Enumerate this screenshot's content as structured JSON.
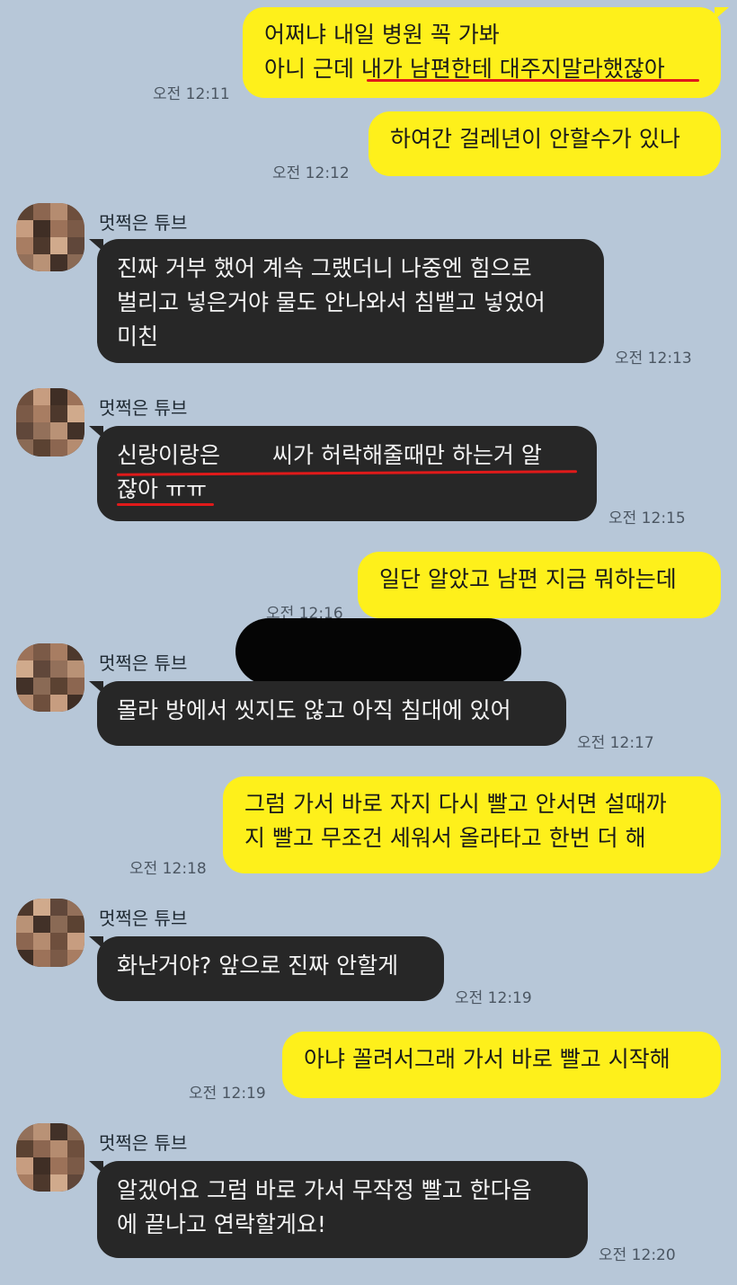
{
  "contact": {
    "name": "멋쩍은 튜브"
  },
  "messages": [
    {
      "from": "me",
      "lines": [
        "어쩌냐 내일 병원 꼭 가봐",
        "아니 근데 내가 남편한테 대주지말라했잖아"
      ],
      "time": "오전 12:11"
    },
    {
      "from": "me",
      "lines": [
        "하여간 걸레년이 안할수가 있나"
      ],
      "time": "오전 12:12"
    },
    {
      "from": "them",
      "lines": [
        "진짜 거부 했어 계속 그랬더니 나중엔 힘으로",
        "벌리고 넣은거야 물도 안나와서 침뱉고 넣었어",
        "미친"
      ],
      "time": "오전 12:13"
    },
    {
      "from": "them",
      "lines": [
        "신랑이랑은",
        "씨가 허락해줄때만 하는거 알",
        "잖아 ㅠㅠ"
      ],
      "time": "오전 12:15"
    },
    {
      "from": "me",
      "lines": [
        "일단 알았고 남편 지금 뭐하는데"
      ],
      "time": "오전 12:16"
    },
    {
      "from": "them",
      "lines": [
        "몰라 방에서 씻지도 않고 아직 침대에 있어"
      ],
      "time": "오전 12:17"
    },
    {
      "from": "me",
      "lines": [
        "그럼 가서 바로 자지 다시 빨고 안서면 설때까",
        "지 빨고 무조건 세워서 올라타고 한번 더 해"
      ],
      "time": "오전 12:18"
    },
    {
      "from": "them",
      "lines": [
        "화난거야? 앞으로 진짜 안할게"
      ],
      "time": "오전 12:19"
    },
    {
      "from": "me",
      "lines": [
        "아냐 꼴려서그래 가서 바로 빨고 시작해"
      ],
      "time": "오전 12:19"
    },
    {
      "from": "them",
      "lines": [
        "알겠어요 그럼 바로 가서 무작정 빨고 한다음",
        "에 끝나고 연락할게요!"
      ],
      "time": "오전 12:20"
    }
  ],
  "colors": {
    "background": "#b7c7d8",
    "outgoing": "#fef01b",
    "incoming": "#272727",
    "annotation": "#e01a1a"
  },
  "icons": {
    "avatar": "pixelated-avatar-icon"
  }
}
